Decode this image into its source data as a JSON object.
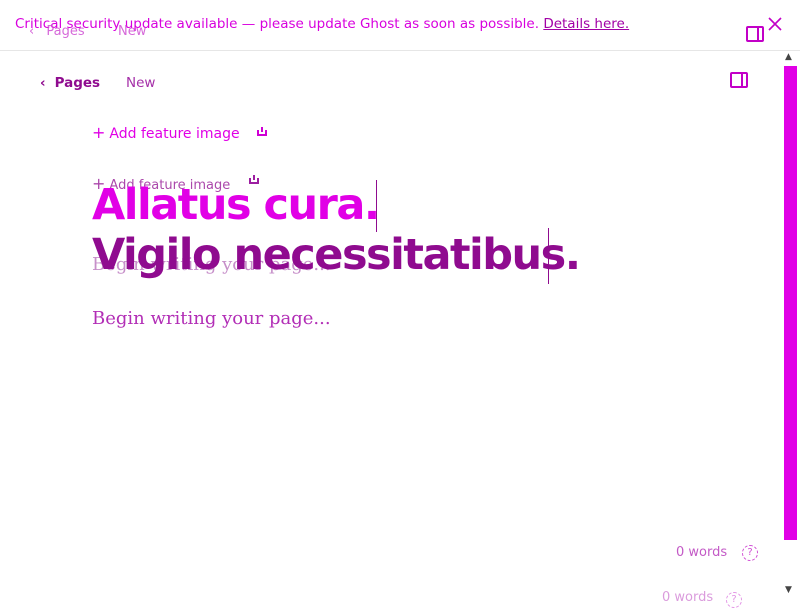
{
  "banner": {
    "message": "Critical security update available — please update Ghost as soon as possible.",
    "link_label": "Details here.",
    "close_icon": "close-icon"
  },
  "nav": {
    "back_label": "Pages",
    "back_icon": "chevron-left-icon",
    "status_label": "New",
    "sidebar_toggle_icon": "sidebar-toggle-icon"
  },
  "feature_image": {
    "label": "Add feature image",
    "plus_icon": "plus-icon",
    "upload_icon": "upload-icon"
  },
  "title": {
    "line1": "Allatus cura.",
    "line2": "Vigilo necessitatibus."
  },
  "body": {
    "placeholder": "Begin writing your page..."
  },
  "footer": {
    "word_count": "0 words",
    "help_icon": "help-icon",
    "help_glyph": "?"
  },
  "colors": {
    "accent": "#e100e6",
    "primary": "#8f0b8f"
  }
}
